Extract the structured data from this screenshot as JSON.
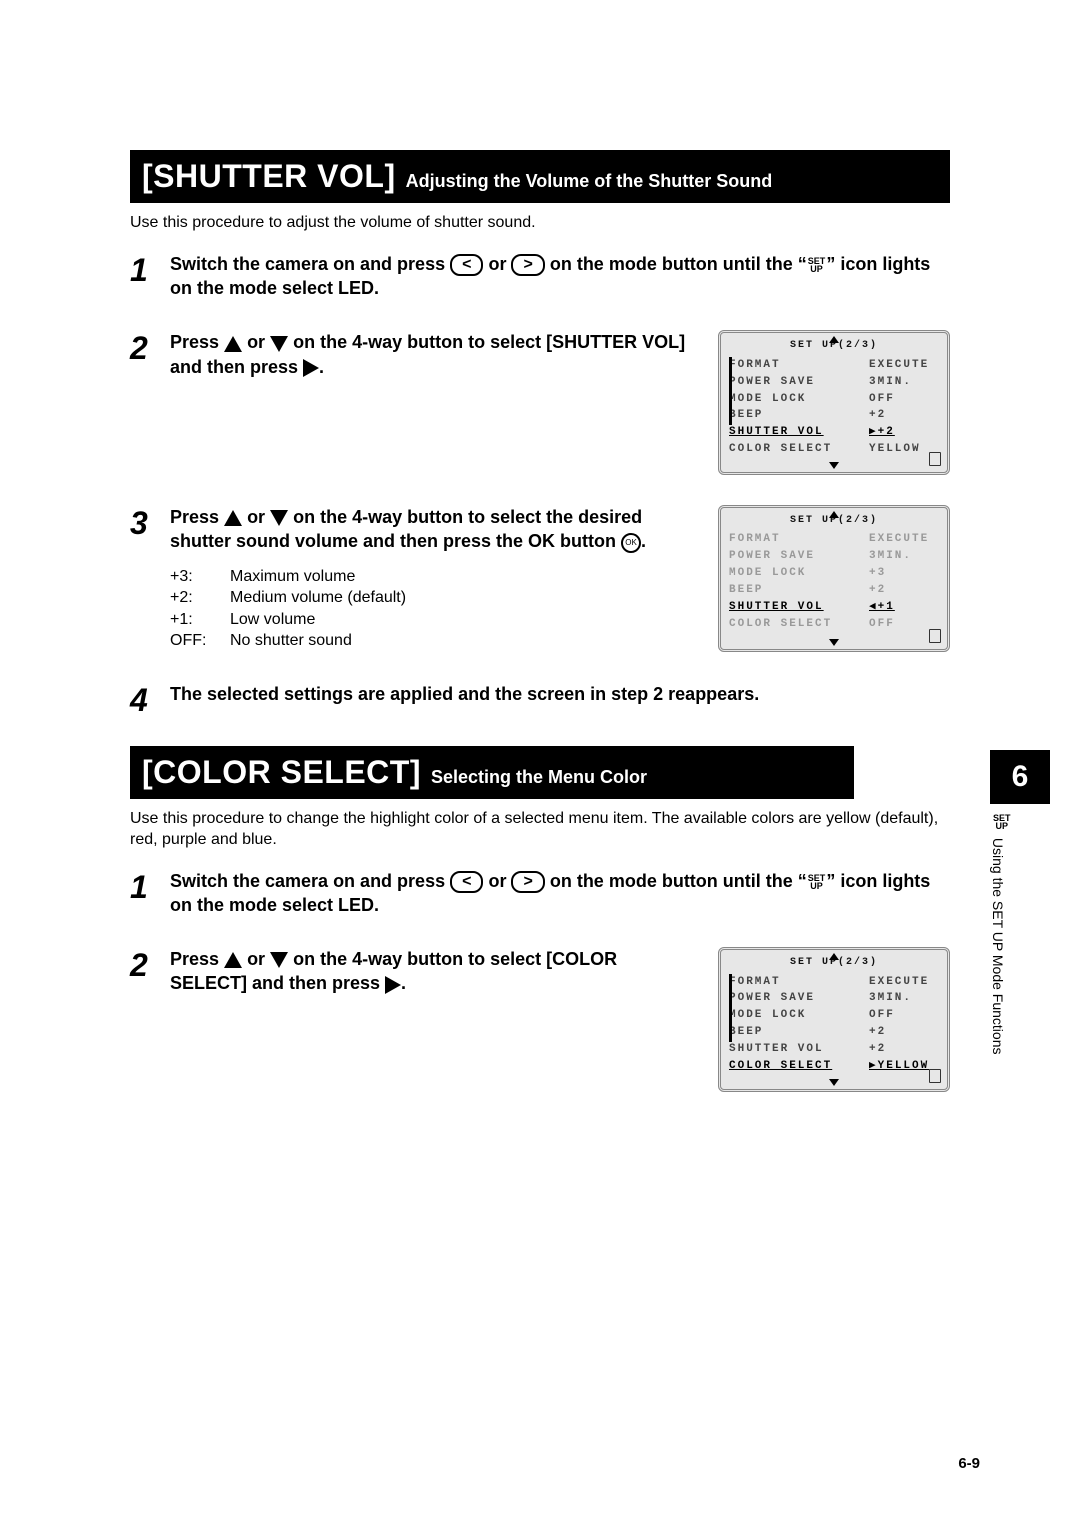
{
  "section1": {
    "heading_big": "[SHUTTER VOL]",
    "heading_small": "Adjusting the Volume of the Shutter Sound",
    "intro": "Use this procedure to adjust the volume of shutter sound.",
    "step1": {
      "num": "1",
      "text_a": "Switch the camera on and press ",
      "text_b": " or ",
      "text_c": " on the mode button until the “",
      "setup": "SET\nUP",
      "text_d": "” icon lights on the mode select LED."
    },
    "step2": {
      "num": "2",
      "text_a": "Press ",
      "text_b": " or ",
      "text_c": " on the 4-way button to select [SHUTTER VOL] and then press ",
      "text_d": "."
    },
    "step3": {
      "num": "3",
      "text_a": "Press ",
      "text_b": " or ",
      "text_c": " on the 4-way button to select the desired shutter sound volume and then press the OK button ",
      "text_d": ".",
      "opts": [
        {
          "k": "+3:",
          "v": "Maximum volume"
        },
        {
          "k": "+2:",
          "v": "Medium volume (default)"
        },
        {
          "k": "+1:",
          "v": "Low volume"
        },
        {
          "k": "OFF:",
          "v": "No shutter sound"
        }
      ]
    },
    "step4": {
      "num": "4",
      "text": "The selected settings are applied and the screen in step 2 reappears."
    }
  },
  "lcd1": {
    "title": "SET UP(2/3)",
    "rows": [
      {
        "l": "FORMAT",
        "v": "EXECUTE"
      },
      {
        "l": "POWER SAVE",
        "v": "3MIN."
      },
      {
        "l": "MODE LOCK",
        "v": "OFF"
      },
      {
        "l": "BEEP",
        "v": "+2"
      },
      {
        "l": "SHUTTER VOL",
        "v": "+2",
        "hl": true,
        "arrow": "right"
      },
      {
        "l": "COLOR SELECT",
        "v": "YELLOW"
      }
    ]
  },
  "lcd2": {
    "title": "SET UP(2/3)",
    "rows": [
      {
        "l": "FORMAT",
        "v": "EXECUTE",
        "dim": true
      },
      {
        "l": "POWER SAVE",
        "v": "3MIN.",
        "dim": true
      },
      {
        "l": "MODE LOCK",
        "v": "+3",
        "dim": true
      },
      {
        "l": "BEEP",
        "v": "+2",
        "dim": true
      },
      {
        "l": "SHUTTER VOL",
        "v": "+1",
        "hl": true,
        "arrow": "left"
      },
      {
        "l": "COLOR SELECT",
        "v": "OFF",
        "dim": true
      }
    ]
  },
  "section2": {
    "heading_big": "[COLOR SELECT]",
    "heading_small": "Selecting the Menu Color",
    "intro": "Use this procedure to change the highlight color of a selected menu item. The available colors are yellow (default), red, purple and blue.",
    "step1": {
      "num": "1",
      "text_a": "Switch the camera on and press ",
      "text_b": " or ",
      "text_c": " on the mode button until the “",
      "setup": "SET\nUP",
      "text_d": "” icon lights on the mode select LED."
    },
    "step2": {
      "num": "2",
      "text_a": "Press ",
      "text_b": " or ",
      "text_c": " on the 4-way button to select [COLOR SELECT] and then press ",
      "text_d": "."
    }
  },
  "lcd3": {
    "title": "SET UP(2/3)",
    "rows": [
      {
        "l": "FORMAT",
        "v": "EXECUTE"
      },
      {
        "l": "POWER SAVE",
        "v": "3MIN."
      },
      {
        "l": "MODE LOCK",
        "v": "OFF"
      },
      {
        "l": "BEEP",
        "v": "+2"
      },
      {
        "l": "SHUTTER VOL",
        "v": "+2"
      },
      {
        "l": "COLOR SELECT",
        "v": "YELLOW",
        "hl": true,
        "arrow": "right"
      }
    ]
  },
  "chapter": {
    "num": "6",
    "label": "Using the SET UP Mode Functions"
  },
  "page_num": "6-9"
}
